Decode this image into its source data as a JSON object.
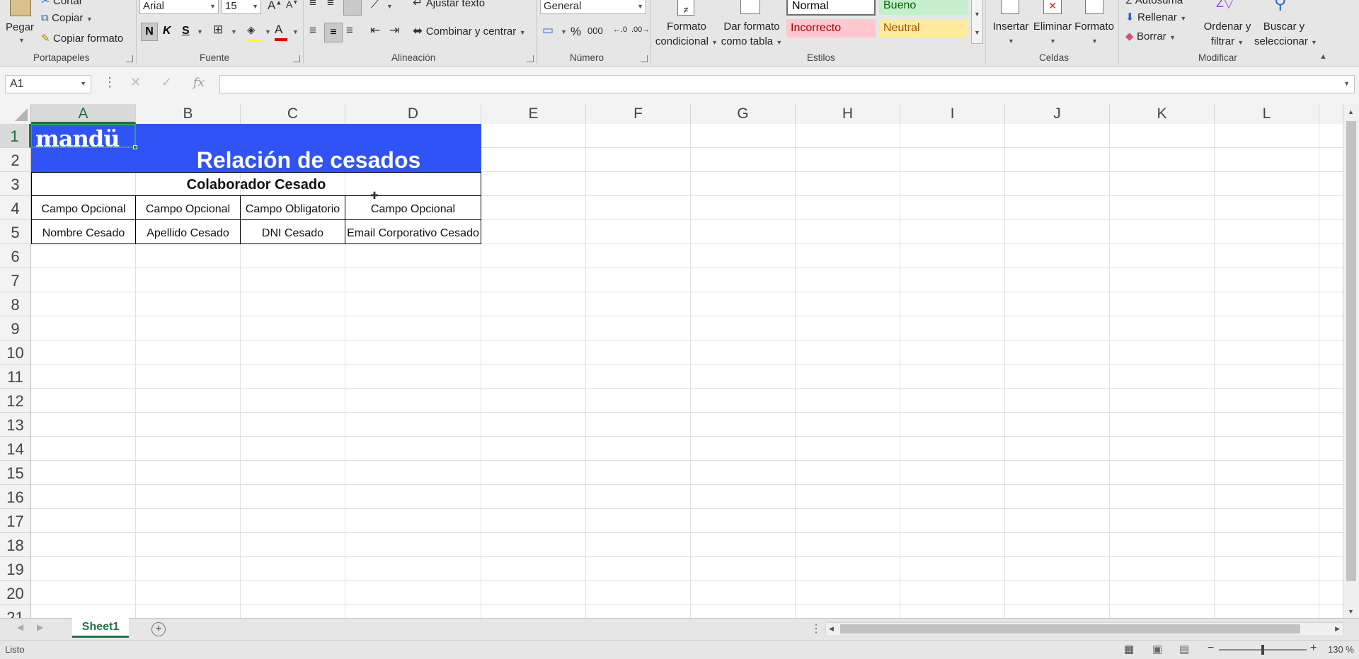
{
  "ribbon": {
    "clipboard": {
      "cut": "Cortar",
      "paste": "Pegar",
      "copy": "Copiar",
      "format_painter": "Copiar formato",
      "group": "Portapapeles"
    },
    "font": {
      "family": "Arial",
      "size": "15",
      "bold": "N",
      "italic": "K",
      "underline": "S",
      "group": "Fuente"
    },
    "alignment": {
      "wrap": "Ajustar texto",
      "merge": "Combinar y centrar",
      "group": "Alineación"
    },
    "number": {
      "format": "General",
      "percent": "%",
      "thousands": "000",
      "group": "Número"
    },
    "styles": {
      "conditional_1": "Formato",
      "conditional_2": "condicional",
      "table_1": "Dar formato",
      "table_2": "como tabla",
      "normal": "Normal",
      "good": "Bueno",
      "bad": "Incorrecto",
      "neutral": "Neutral",
      "group": "Estilos"
    },
    "cells": {
      "insert": "Insertar",
      "delete": "Eliminar",
      "format": "Formato",
      "group": "Celdas"
    },
    "editing": {
      "autosum": "Autosuma",
      "fill": "Rellenar",
      "clear": "Borrar",
      "sort_1": "Ordenar y",
      "sort_2": "filtrar",
      "find_1": "Buscar y",
      "find_2": "seleccionar",
      "group": "Modificar"
    }
  },
  "formula_bar": {
    "name_box": "A1",
    "fx": "fx",
    "content": ""
  },
  "columns": [
    "A",
    "B",
    "C",
    "D",
    "E",
    "F",
    "G",
    "H",
    "I",
    "J",
    "K",
    "L"
  ],
  "rows": [
    "1",
    "2",
    "3",
    "4",
    "5",
    "6",
    "7",
    "8",
    "9",
    "10",
    "11",
    "12",
    "13",
    "14",
    "15",
    "16",
    "17",
    "18",
    "19",
    "20",
    "21"
  ],
  "sheet": {
    "logo": "mandü",
    "title": "Relación de cesados",
    "section": "Colaborador Cesado",
    "row4": [
      "Campo Opcional",
      "Campo Opcional",
      "Campo Obligatorio",
      "Campo Opcional"
    ],
    "row5": [
      "Nombre Cesado",
      "Apellido Cesado",
      "DNI Cesado",
      "Email Corporativo Cesado"
    ]
  },
  "tabs": {
    "active": "Sheet1"
  },
  "status": {
    "mode": "Listo",
    "zoom": "130 %"
  },
  "colors": {
    "header_fill": "#3053f5",
    "accent": "#217346",
    "good_fill": "#c6efce",
    "bad_fill": "#ffc7ce",
    "neutral_fill": "#ffeb9c"
  }
}
